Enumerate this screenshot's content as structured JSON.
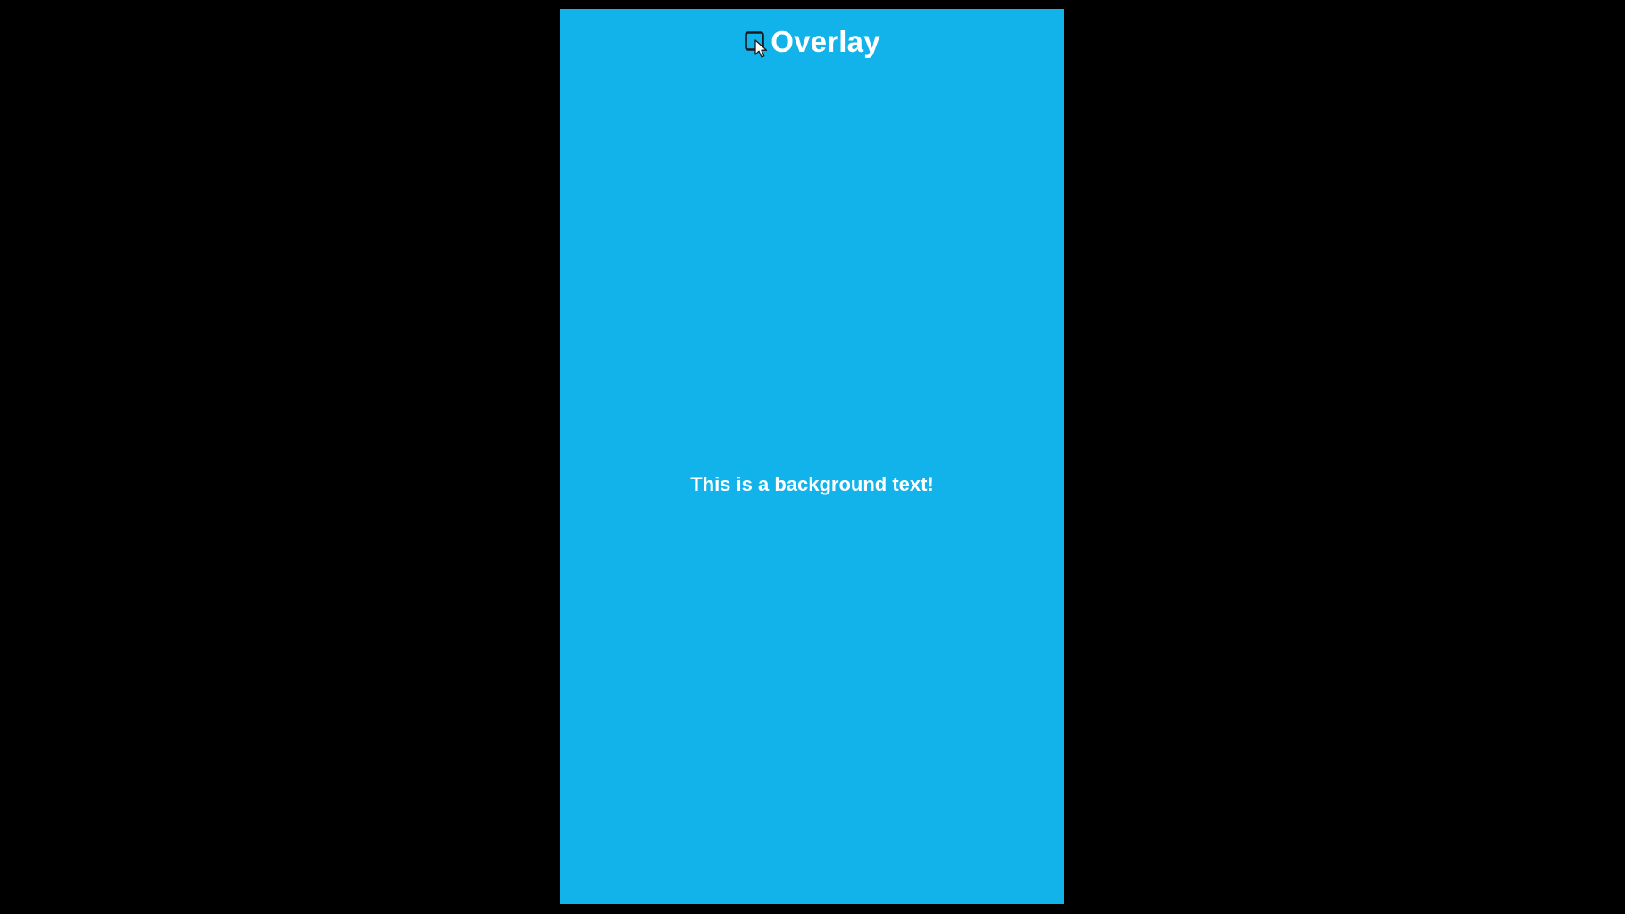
{
  "app": {
    "title": "Overlay"
  },
  "header": {
    "toggle_icon": "checkbox-outline-icon",
    "cursor_icon": "mouse-pointer-icon"
  },
  "main": {
    "background_text": "This is a background text!"
  },
  "colors": {
    "page_background": "#000000",
    "screen_background": "#12b3eb",
    "text": "#ffffff",
    "icon": "#1a1a1a"
  }
}
